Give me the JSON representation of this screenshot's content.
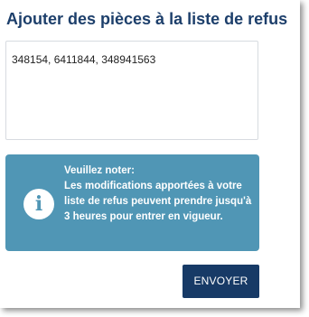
{
  "title": "Ajouter des pièces à la liste de refus",
  "parts_input": {
    "value": "348154, 6411844, 348941563"
  },
  "notice": {
    "icon": "info-icon",
    "icon_glyph": "i",
    "heading": "Veuillez noter:",
    "body": "Les modifications apportées à votre liste de refus peuvent prendre jusqu'à 3 heures pour entrer en vigueur."
  },
  "submit_label": "ENVOYER",
  "colors": {
    "title": "#1d3f6b",
    "notice_bg": "#5096b5",
    "notice_icon": "#5096b5",
    "button_bg": "#173a66"
  }
}
